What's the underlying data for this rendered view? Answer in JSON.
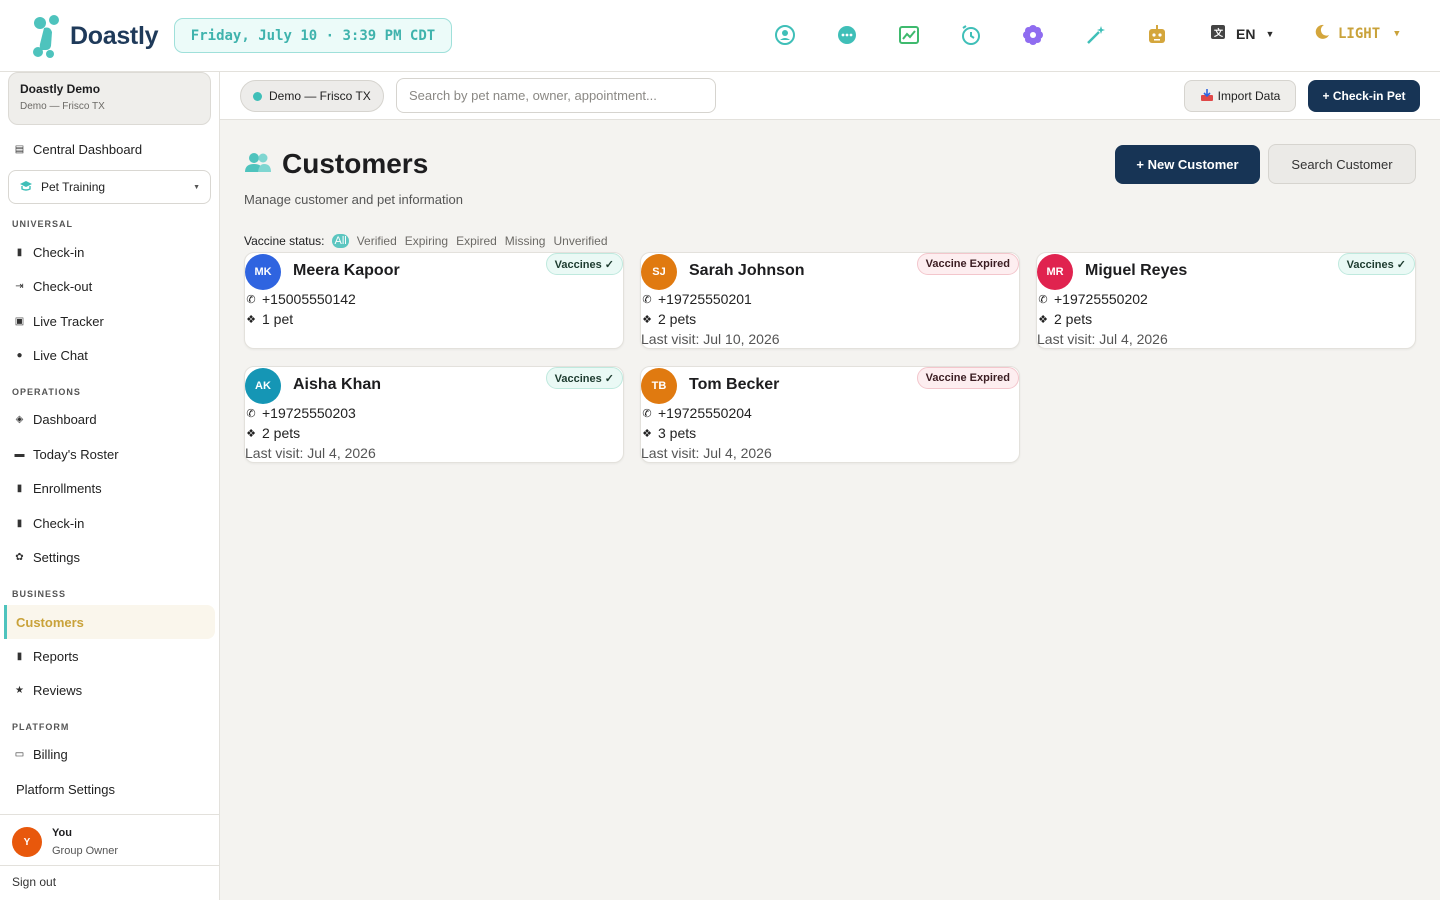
{
  "app": {
    "brand": "Doastly"
  },
  "header": {
    "datetime": "Friday, July 10 · 3:39 PM CDT",
    "icons": [
      "support-icon",
      "chat-icon",
      "chart-icon",
      "clock-icon",
      "flower-icon",
      "magic-wand-icon",
      "robot-icon"
    ],
    "language": "EN",
    "theme": "LIGHT"
  },
  "org": {
    "name": "Doastly Demo",
    "location": "Demo — Frisco TX"
  },
  "sidebar": {
    "central": "Central Dashboard",
    "mode": "Pet Training",
    "sections": {
      "universal": "UNIVERSAL",
      "operations": "OPERATIONS",
      "business": "BUSINESS",
      "platform": "PLATFORM"
    },
    "universal": [
      "Check-in",
      "Check-out",
      "Live Tracker",
      "Live Chat"
    ],
    "operations": [
      "Dashboard",
      "Today's Roster",
      "Enrollments",
      "Check-in",
      "Settings"
    ],
    "business": [
      "Customers",
      "Reports",
      "Reviews"
    ],
    "platform": [
      "Billing",
      "Platform Settings"
    ],
    "user": {
      "initial": "Y",
      "name": "You",
      "role": "Group Owner"
    },
    "signout": "Sign out"
  },
  "subheader": {
    "location": "Demo — Frisco TX",
    "search_placeholder": "Search by pet name, owner, appointment...",
    "import": "Import Data",
    "checkin": "+ Check-in Pet"
  },
  "page": {
    "title": "Customers",
    "subtitle": "Manage customer and pet information",
    "new_customer": "+ New Customer",
    "search_customer": "Search Customer",
    "filter_label": "Vaccine status:",
    "filters": [
      "All",
      "Verified",
      "Expiring",
      "Expired",
      "Missing",
      "Unverified"
    ]
  },
  "customers": [
    {
      "initials": "MK",
      "name": "Meera Kapoor",
      "phone": "+15005550142",
      "pets": "1 pet",
      "last_visit": "",
      "badge": "Vaccines ✓",
      "badge_status": "ok",
      "color": "#2f64e0"
    },
    {
      "initials": "SJ",
      "name": "Sarah Johnson",
      "phone": "+19725550201",
      "pets": "2 pets",
      "last_visit": "Last visit: Jul 10, 2026",
      "badge": "Vaccine Expired",
      "badge_status": "bad",
      "color": "#e07a10"
    },
    {
      "initials": "MR",
      "name": "Miguel Reyes",
      "phone": "+19725550202",
      "pets": "2 pets",
      "last_visit": "Last visit: Jul 4, 2026",
      "badge": "Vaccines ✓",
      "badge_status": "ok",
      "color": "#e0234f"
    },
    {
      "initials": "AK",
      "name": "Aisha Khan",
      "phone": "+19725550203",
      "pets": "2 pets",
      "last_visit": "Last visit: Jul 4, 2026",
      "badge": "Vaccines ✓",
      "badge_status": "ok",
      "color": "#1596b5"
    },
    {
      "initials": "TB",
      "name": "Tom Becker",
      "phone": "+19725550204",
      "pets": "3 pets",
      "last_visit": "Last visit: Jul 4, 2026",
      "badge": "Vaccine Expired",
      "badge_status": "bad",
      "color": "#e07a10"
    }
  ],
  "colors": {
    "navy": "#173455",
    "teal": "#3fbfb8",
    "gold": "#c9a23a"
  }
}
